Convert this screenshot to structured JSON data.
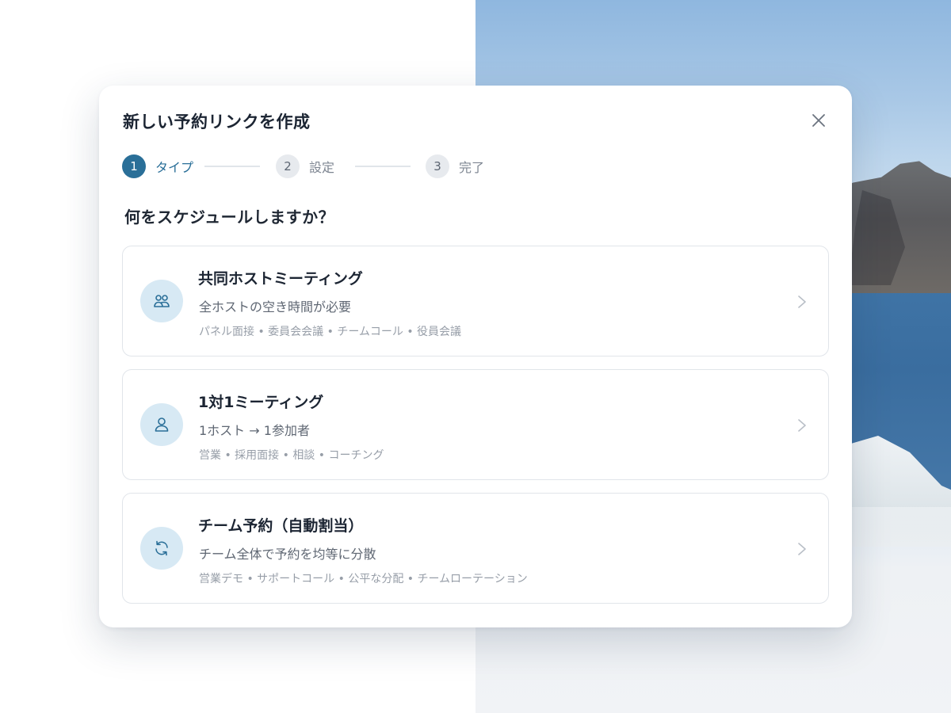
{
  "modal": {
    "title": "新しい予約リンクを作成",
    "close_icon": "close-icon"
  },
  "stepper": {
    "steps": [
      {
        "number": "1",
        "label": "タイプ",
        "active": true
      },
      {
        "number": "2",
        "label": "設定",
        "active": false
      },
      {
        "number": "3",
        "label": "完了",
        "active": false
      }
    ]
  },
  "question": "何をスケジュールしますか？",
  "options": [
    {
      "icon": "group-icon",
      "title": "共同ホストミーティング",
      "description": "全ホストの空き時間が必要",
      "examples": "パネル面接 • 委員会会議 • チームコール • 役員会議"
    },
    {
      "icon": "person-icon",
      "title": "1対1ミーティング",
      "description": "1ホスト → 1参加者",
      "examples": "営業 • 採用面接 • 相談 • コーチング"
    },
    {
      "icon": "rotate-icon",
      "title": "チーム予約（自動割当）",
      "description": "チーム全体で予約を均等に分散",
      "examples": "営業デモ • サポートコール • 公平な分配 • チームローテーション"
    }
  ],
  "colors": {
    "accent": "#2a6f98",
    "icon_bg": "#d7e9f4",
    "border": "#e1e5ea"
  }
}
